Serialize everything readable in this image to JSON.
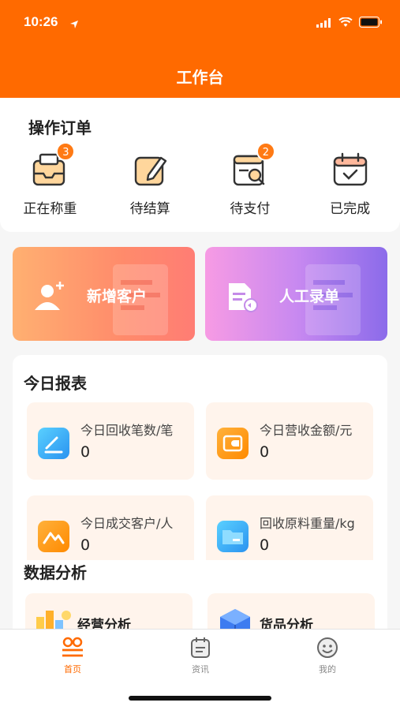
{
  "status": {
    "time": "10:26"
  },
  "header": {
    "title": "工作台"
  },
  "orders": {
    "title": "操作订单",
    "items": [
      {
        "label": "正在称重",
        "badge": "3"
      },
      {
        "label": "待结算",
        "badge": ""
      },
      {
        "label": "待支付",
        "badge": "2"
      },
      {
        "label": "已完成",
        "badge": ""
      }
    ]
  },
  "actions": {
    "add_customer": "新增客户",
    "manual_entry": "人工录单"
  },
  "report": {
    "title": "今日报表",
    "stats": [
      {
        "label": "今日回收笔数/笔",
        "value": "0"
      },
      {
        "label": "今日营收金额/元",
        "value": "0"
      },
      {
        "label": "今日成交客户/人",
        "value": "0"
      },
      {
        "label": "回收原料重量/kg",
        "value": "0"
      }
    ]
  },
  "analysis": {
    "title": "数据分析",
    "items": [
      {
        "label": "经营分析"
      },
      {
        "label": "货品分析"
      }
    ]
  },
  "tabs": [
    {
      "label": "首页",
      "active": true
    },
    {
      "label": "资讯",
      "active": false
    },
    {
      "label": "我的",
      "active": false
    }
  ],
  "colors": {
    "brand": "#ff6a00",
    "badge": "#ff7a14"
  }
}
